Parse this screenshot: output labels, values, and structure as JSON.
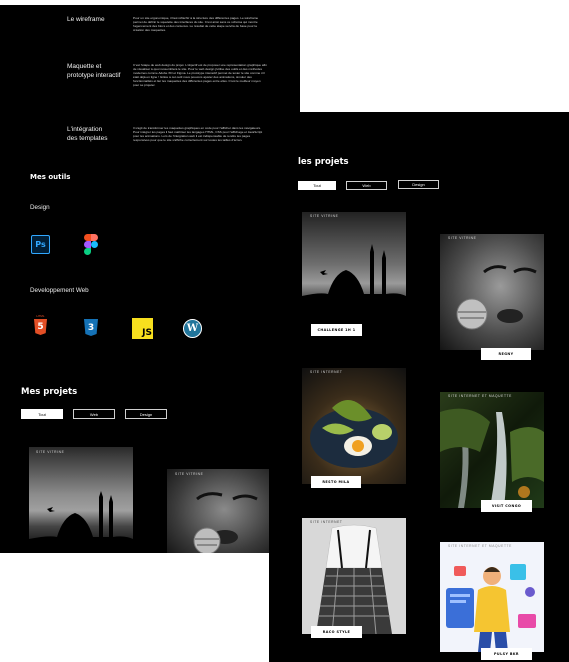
{
  "steps": [
    {
      "title_line1": "Le wireframe",
      "title_line2": "",
      "body": "Pour un site ergonomique, il faut réfléchir à la structure des différentes pages. Le wireframe permet de définir le squelette des interfaces du site. C'est ainsi sans ce schéma qui montre l'agencement des blocs et des contenus. Le résultat de cette étape servira de base pour la création des maquettes."
    },
    {
      "title_line1": "Maquette et",
      "title_line2": "prototype interactif",
      "body": "C'est l'étape de web design du projet. L'objectif est de proposer une représentation graphique afin de visualiser à quoi ressemblera le site. Pour le web design j'utilise des outils et des méthodes modernes comme Adobe XD et Figma. Le prototype interactif permet de tester le site comme s'il était déjà en ligne ! Grâce à cet outil nous pouvons ajuster des animations, simuler des fonctionnalités et lier les maquettes des différentes pages entre elles. C'est le meilleur moyen pour se projeter."
    },
    {
      "title_line1": "L'intégration",
      "title_line2": "des templates",
      "body": "Il s'agit de transformer les maquettes graphiques en code pour l'afficher dans les navigateurs. Pour intégrer les pages il faut maîtriser les langages HTML, CSS pour l'affichage et JavaScript pour les animations. Lors de l'intégration web il est indispensable de rendre les pages responsives pour que le site s'affiche correctement sur toutes les tailles d'écran."
    }
  ],
  "tools": {
    "title": "Mes outils",
    "design_label": "Design",
    "dev_label": "Developpement Web",
    "design_icons": [
      {
        "name": "photoshop-icon",
        "text": "Ps"
      },
      {
        "name": "figma-icon",
        "text": ""
      }
    ],
    "dev_icons": [
      {
        "name": "html5-icon",
        "text": "5",
        "caption": "HTML"
      },
      {
        "name": "css3-icon",
        "text": "3"
      },
      {
        "name": "javascript-icon",
        "text": "JS"
      },
      {
        "name": "wordpress-icon",
        "text": "W"
      }
    ]
  },
  "projects_a": {
    "title": "Mes projets",
    "filters": [
      "Tout",
      "Web",
      "Design"
    ],
    "cards": [
      {
        "category": "SITE VITRINE"
      },
      {
        "category": "SITE VITRINE"
      }
    ]
  },
  "projects_b": {
    "title": "les projets",
    "filters": [
      "Tout",
      "Web",
      "Design"
    ],
    "cards": [
      {
        "category": "SITE VITRINE",
        "label": "CHALLENGE 1H 1"
      },
      {
        "category": "SITE VITRINE",
        "label": "REGNY"
      },
      {
        "category": "SITE INTERNET",
        "label": "RESTO MILA"
      },
      {
        "category": "SITE INTERNET ET MAQUETTE",
        "label": "VISIT CONGO"
      },
      {
        "category": "SITE INTERNET",
        "label": "RACO STYLE"
      },
      {
        "category": "SITE INTERNET ET MAQUETTE",
        "label": "PULSY BKR"
      }
    ]
  },
  "colors": {
    "background": "#000000",
    "text": "#ffffff",
    "page": "#ffffff"
  }
}
